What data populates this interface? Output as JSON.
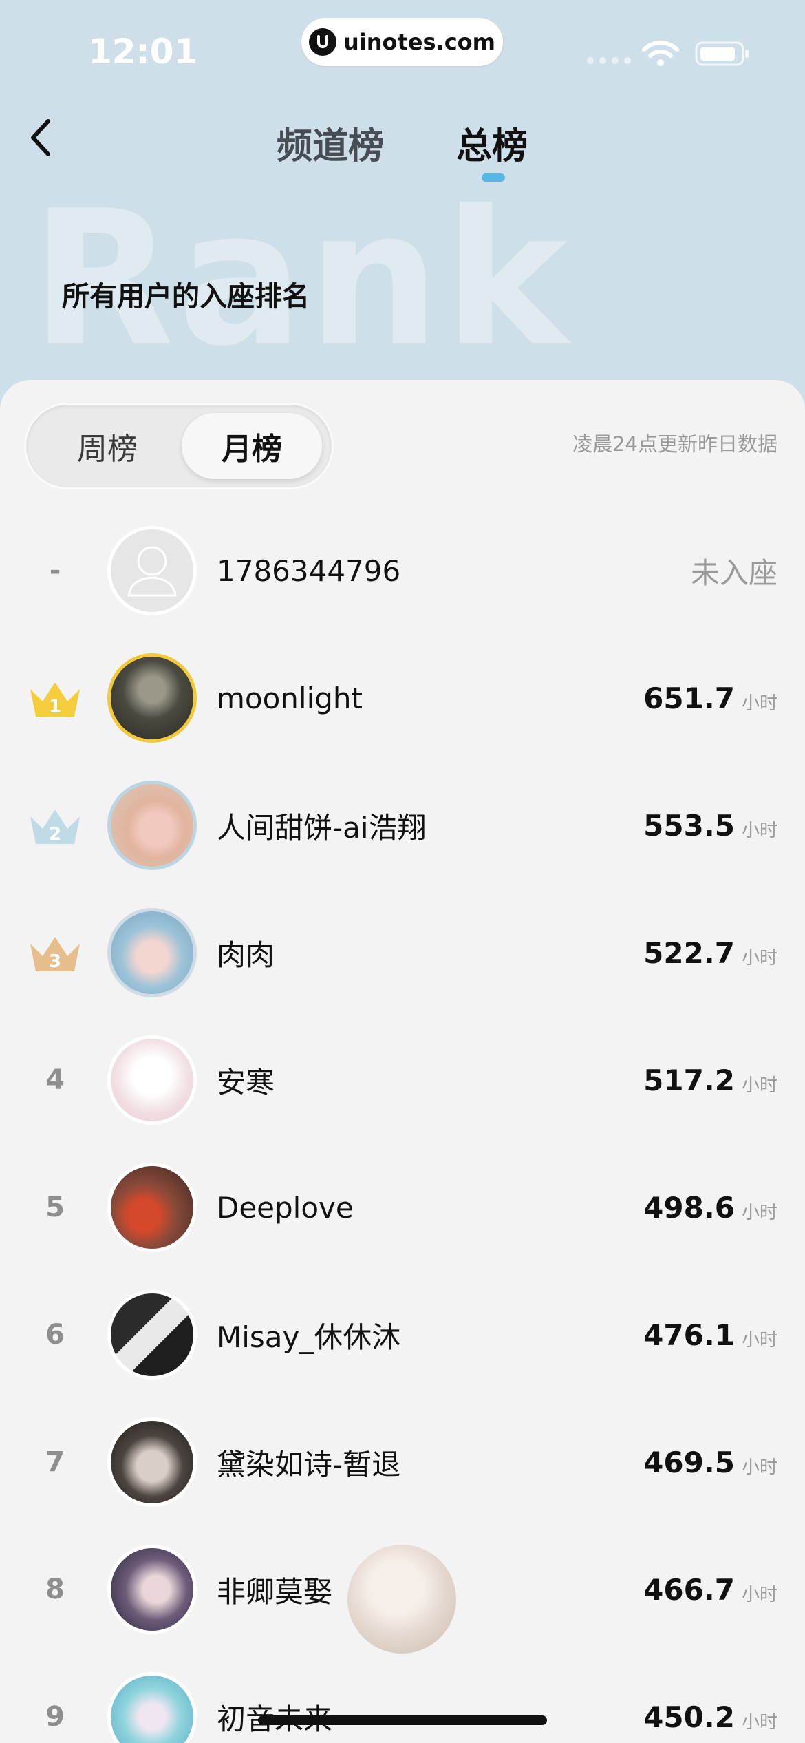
{
  "status_bar": {
    "time": "12:01",
    "url": "uinotes.com"
  },
  "nav": {
    "tabs": [
      {
        "label": "频道榜",
        "active": false
      },
      {
        "label": "总榜",
        "active": true
      }
    ],
    "back_icon": "chevron-left-icon",
    "accent_color": "#55b7e6"
  },
  "header": {
    "watermark": "Rank",
    "subtitle": "所有用户的入座排名"
  },
  "period_switch": {
    "options": [
      "周榜",
      "月榜"
    ],
    "selected": "月榜",
    "update_note": "凌晨24点更新昨日数据"
  },
  "self_row": {
    "rank": "-",
    "name": "1786344796",
    "status": "未入座"
  },
  "unit": "小时",
  "ranking": [
    {
      "rank": "1",
      "name": "moonlight",
      "score": "651.7",
      "crown": "gold-crown-icon"
    },
    {
      "rank": "2",
      "name": "人间甜饼-ai浩翔",
      "score": "553.5",
      "crown": "silver-crown-icon"
    },
    {
      "rank": "3",
      "name": "肉肉",
      "score": "522.7",
      "crown": "bronze-crown-icon"
    },
    {
      "rank": "4",
      "name": "安寒",
      "score": "517.2"
    },
    {
      "rank": "5",
      "name": "Deeplove",
      "score": "498.6"
    },
    {
      "rank": "6",
      "name": "Misay_休休沐",
      "score": "476.1"
    },
    {
      "rank": "7",
      "name": "黛染如诗-暂退",
      "score": "469.5"
    },
    {
      "rank": "8",
      "name": "非卿莫娶",
      "score": "466.7"
    },
    {
      "rank": "9",
      "name": "初音未来",
      "score": "450.2"
    }
  ]
}
